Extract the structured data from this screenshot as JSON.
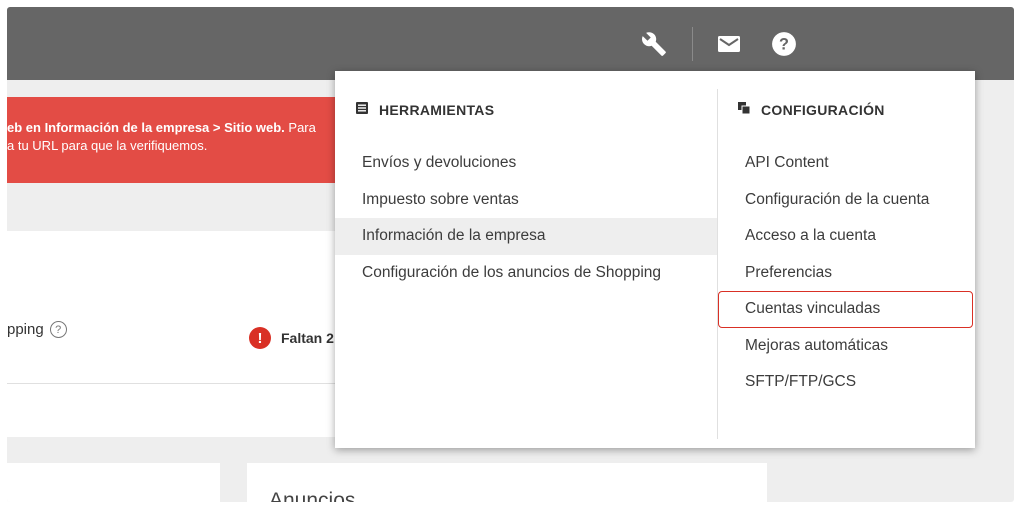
{
  "alert": {
    "line1_bold": "eb en Información de la empresa > Sitio web.",
    "line1_rest": " Para",
    "line2": "a tu URL para que la verifiquemos."
  },
  "status_row": {
    "label": "pping",
    "help_glyph": "?"
  },
  "warning": {
    "glyph": "!",
    "text": "Faltan 2"
  },
  "card_title": "Anuncios",
  "menu": {
    "tools": {
      "header": "HERRAMIENTAS",
      "items": [
        "Envíos y devoluciones",
        "Impuesto sobre ventas",
        "Información de la empresa",
        "Configuración de los anuncios de Shopping"
      ]
    },
    "settings": {
      "header": "CONFIGURACIÓN",
      "items": [
        "API Content",
        "Configuración de la cuenta",
        "Acceso a la cuenta",
        "Preferencias",
        "Cuentas vinculadas",
        "Mejoras automáticas",
        "SFTP/FTP/GCS"
      ]
    }
  },
  "icons": {
    "tools": "wrench-icon",
    "mail": "mail-icon",
    "help": "help-icon"
  },
  "colors": {
    "topbar": "#666666",
    "alert": "#e34c45",
    "highlight": "#d93025"
  }
}
